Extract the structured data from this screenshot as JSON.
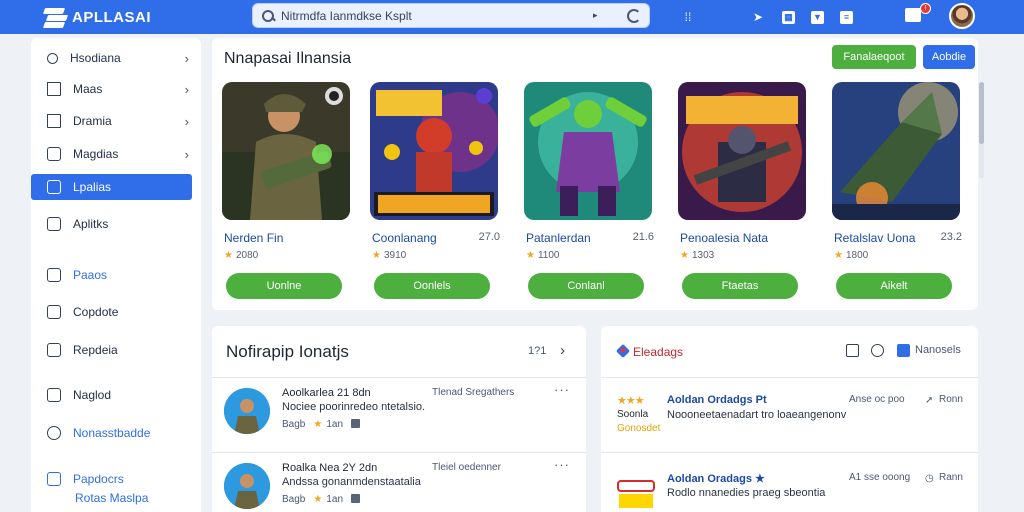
{
  "app": {
    "title": "APLLASAI"
  },
  "search": {
    "value": "Nitrmdfa Ianmdkse Ksplt",
    "placeholder": ""
  },
  "sidebar": {
    "items": [
      {
        "label": "Hsodiana",
        "icon": "search-icon"
      },
      {
        "label": "Maas",
        "icon": "home-icon"
      },
      {
        "label": "Dramia",
        "icon": "house-icon"
      },
      {
        "label": "Magdias",
        "icon": "tag-icon"
      },
      {
        "label": "Lpalias",
        "icon": "list-icon"
      },
      {
        "label": "Aplitks",
        "icon": "grid-icon"
      },
      {
        "label": "Paaos",
        "icon": "folder-icon"
      },
      {
        "label": "Copdote",
        "icon": "briefcase-icon"
      },
      {
        "label": "Repdeia",
        "icon": "lock-icon"
      },
      {
        "label": "Naglod",
        "icon": "bookmark-icon"
      },
      {
        "label": "Nonasstbadde",
        "icon": "circle-icon"
      },
      {
        "label": "Papdocrs",
        "icon": "cloud-icon"
      }
    ],
    "sub_label": "Rotas Maslpa"
  },
  "featured": {
    "title": "Nnapasai Ilnansia",
    "primary_button": "Fanalaeqoot",
    "secondary_button": "Aobdie",
    "cards": [
      {
        "name": "Nerden Fin",
        "size": "",
        "rating": "2080",
        "button": "Uonlne"
      },
      {
        "name": "Coonlanang",
        "size": "27.0",
        "rating": "3910",
        "button": "Oonlels"
      },
      {
        "name": "Patanlerdan",
        "size": "21.6",
        "rating": "1100",
        "button": "Conlanl"
      },
      {
        "name": "Penoalesia Nata",
        "size": "",
        "rating": "1303",
        "button": "Ftaetas"
      },
      {
        "name": "Retalslav Uona",
        "size": "23.2",
        "rating": "1800",
        "button": "Aikelt"
      }
    ]
  },
  "news": {
    "title": "Nofirapip Ionatjs",
    "count": "1?1",
    "rows": [
      {
        "title": "Aoolkarlea 21 8dn",
        "meta": "Tlenad Sregathers",
        "desc": "Nociee poorinredeo ntetalsio.",
        "by": "Bagb",
        "rating": "1an"
      },
      {
        "title": "Roalka Nea 2Y 2dn",
        "meta": "Tleiel oedenner",
        "desc": "Andssa gonanmdenstaatalia",
        "by": "Bagb",
        "rating": "1an"
      }
    ]
  },
  "deals": {
    "title": "Eleadags",
    "label": "Nanosels",
    "rows": [
      {
        "stars": "★★★",
        "tag1": "Soonla",
        "tag2": "Gonosdet",
        "title": "Aoldan Ordadgs Pt",
        "meta": "Anse oc poo",
        "right": "Ronn",
        "desc": "Noooneetaenadart tro loaeangenonv"
      },
      {
        "title": "Aoldan Oradags ★",
        "meta": "A1 sse ooong",
        "right": "Rann",
        "desc": "Rodlo nnanedies praeg sbeontia"
      }
    ]
  },
  "colors": {
    "accent": "#2f6ee8",
    "success": "#4caf3e",
    "star": "#f0a623"
  }
}
